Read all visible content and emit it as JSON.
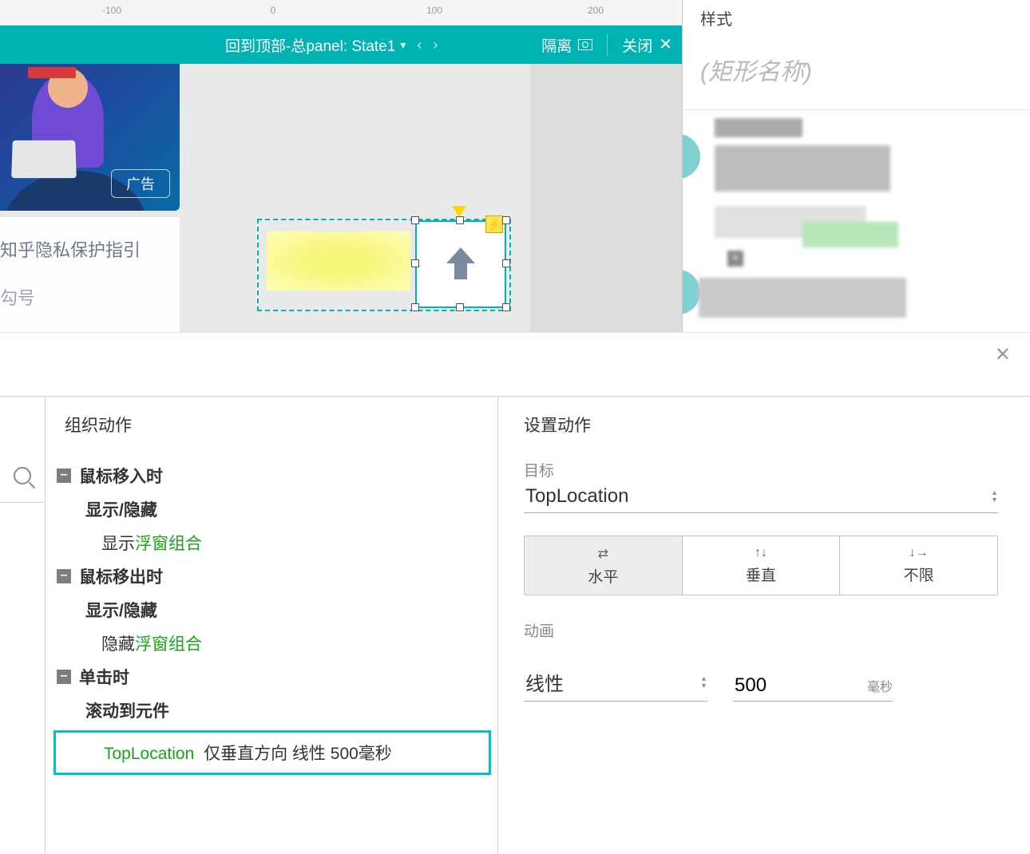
{
  "ruler": {
    "labels": [
      "-100",
      "0",
      "100",
      "200"
    ]
  },
  "stateBar": {
    "title": "回到顶部-总panel:  State1",
    "isolate": "隔离",
    "close": "关闭"
  },
  "canvas": {
    "adBadge": "广告",
    "line1": "知乎隐私保护指引",
    "line2": "勾号"
  },
  "rightPanel": {
    "header": "样式",
    "namePlaceholder": "(矩形名称)"
  },
  "actionsPanel": {
    "title": "组织动作",
    "events": [
      {
        "name": "鼠标移入时",
        "action": "显示/隐藏",
        "detailPrefix": "显示 ",
        "detailTarget": "浮窗组合"
      },
      {
        "name": "鼠标移出时",
        "action": "显示/隐藏",
        "detailPrefix": "隐藏 ",
        "detailTarget": "浮窗组合"
      },
      {
        "name": "单击时",
        "action": "滚动到元件",
        "selected": {
          "target": "TopLocation",
          "rest": " 仅垂直方向 线性 500毫秒"
        }
      }
    ]
  },
  "settingsPanel": {
    "title": "设置动作",
    "targetLabel": "目标",
    "targetValue": "TopLocation",
    "direction": {
      "options": [
        "水平",
        "垂直",
        "不限"
      ],
      "active": 0
    },
    "animLabel": "动画",
    "easing": "线性",
    "duration": "500",
    "unit": "毫秒"
  }
}
